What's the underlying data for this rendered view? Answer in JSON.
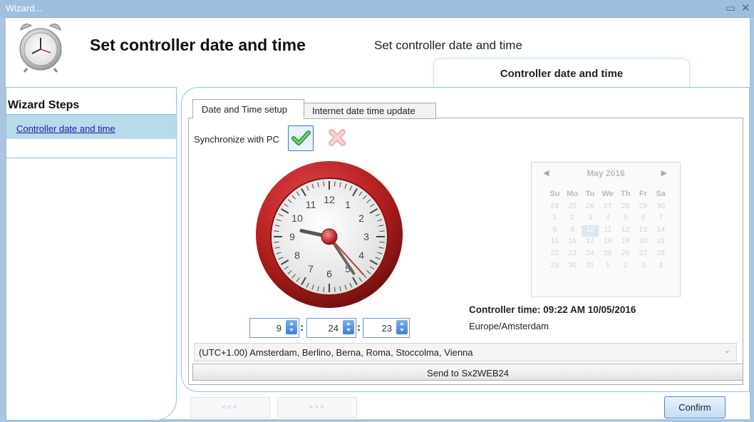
{
  "window": {
    "title": "Wizard...",
    "icons": [
      "restore-icon",
      "close-icon"
    ]
  },
  "header": {
    "title": "Set controller date and time",
    "subtitle": "Set controller date and time",
    "step_tab": "Controller date and time",
    "icon": "alarm-clock-icon"
  },
  "sidebar": {
    "title": "Wizard Steps",
    "items": [
      {
        "label": "Controller date and time"
      }
    ]
  },
  "tabs": [
    {
      "label": "Date and Time setup",
      "active": true
    },
    {
      "label": "Internet date time update",
      "active": false
    }
  ],
  "sync": {
    "label": "Synchronize with PC",
    "accept_icon": "checkmark-icon",
    "reject_icon": "cross-icon"
  },
  "clock": {
    "numbers": [
      "12",
      "1",
      "2",
      "3",
      "4",
      "5",
      "6",
      "7",
      "8",
      "9",
      "10",
      "11"
    ],
    "hour": 9,
    "minute": 24,
    "second": 23
  },
  "time_inputs": {
    "hours": "9",
    "minutes": "24",
    "seconds": "23",
    "separator": ":"
  },
  "calendar": {
    "month_label": "May 2016",
    "prev_icon": "◀",
    "next_icon": "▶",
    "weekdays": [
      "Su",
      "Mo",
      "Tu",
      "We",
      "Th",
      "Fr",
      "Sa"
    ],
    "days": [
      "24",
      "25",
      "26",
      "27",
      "28",
      "29",
      "30",
      "1",
      "2",
      "3",
      "4",
      "5",
      "6",
      "7",
      "8",
      "9",
      "10",
      "11",
      "12",
      "13",
      "14",
      "15",
      "16",
      "17",
      "18",
      "19",
      "20",
      "21",
      "22",
      "23",
      "24",
      "25",
      "26",
      "27",
      "28",
      "29",
      "30",
      "31",
      "1",
      "2",
      "3",
      "4"
    ],
    "selected_day": "10"
  },
  "controller": {
    "time_label": "Controller time: 09:22 AM 10/05/2016",
    "timezone_name": "Europe/Amsterdam"
  },
  "timezone_select": {
    "value": "(UTC+1.00) Amsterdam, Berlino, Berna, Roma, Stoccolma, Vienna",
    "chevron": "⌄"
  },
  "actions": {
    "send": "Send to Sx2WEB24",
    "prev": "<<<",
    "next": ">>>",
    "confirm": "Confirm"
  },
  "colors": {
    "titlebar": "#9fbfdf",
    "accent": "#8fc3dd",
    "clock_red": "#b51f1f",
    "check_green": "#3aa23a"
  }
}
